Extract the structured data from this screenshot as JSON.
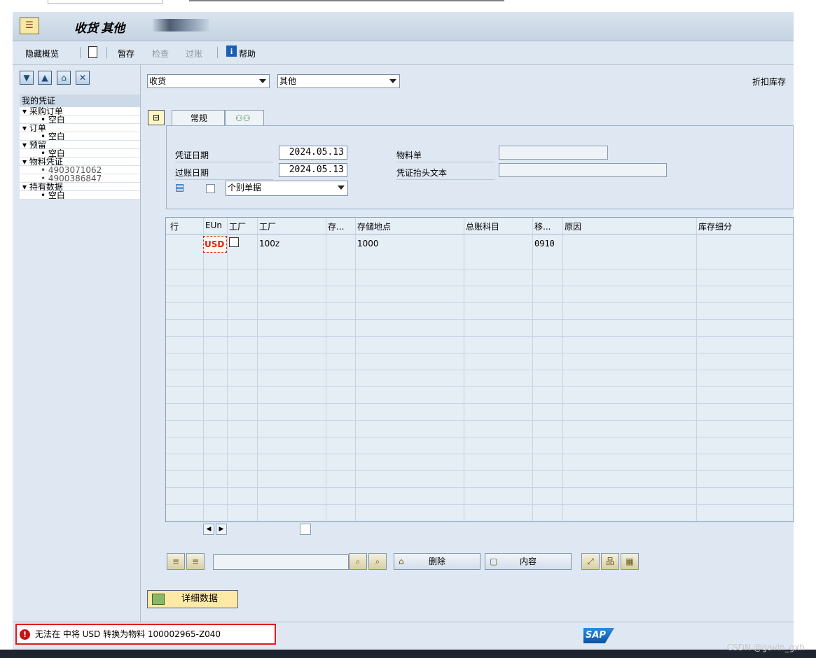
{
  "window": {
    "title": "收货 其他"
  },
  "toolbar": {
    "hide_overview": "隐藏概览",
    "save_draft": "暂存",
    "check": "检查",
    "post": "过账",
    "help": "帮助"
  },
  "tree": {
    "header": "我的凭证",
    "groups": [
      {
        "label": "采购订单",
        "children": [
          "空白"
        ]
      },
      {
        "label": "订单",
        "children": [
          "空白"
        ]
      },
      {
        "label": "预留",
        "children": [
          "空白"
        ]
      },
      {
        "label": "物料凭证",
        "children": [
          "4903071062",
          "4900386847"
        ]
      },
      {
        "label": "持有数据",
        "children": [
          "空白"
        ]
      }
    ]
  },
  "header": {
    "transaction": "收货",
    "reference": "其他",
    "right_label": "折扣库存"
  },
  "tabs": [
    {
      "label": "常规"
    },
    {
      "label": "",
      "icon": "persons-icon"
    }
  ],
  "form": {
    "doc_date_label": "凭证日期",
    "doc_date": "2024.05.13",
    "post_date_label": "过账日期",
    "post_date": "2024.05.13",
    "print_option": "个别单据",
    "material_slip_label": "物料单",
    "material_slip": "",
    "header_text_label": "凭证抬头文本",
    "header_text": ""
  },
  "grid": {
    "columns": [
      "行",
      "EUn",
      "工厂",
      "工厂",
      "存...",
      "存储地点",
      "总账科目",
      "移...",
      "原因",
      "库存细分"
    ],
    "rows": [
      {
        "line": "",
        "eun": "USD",
        "plant": "100z",
        "storage": "1000",
        "mvmt": "0910"
      }
    ]
  },
  "buttons": {
    "delete": "删除",
    "content": "内容",
    "detail": "详细数据"
  },
  "status": {
    "type": "error",
    "message": "无法在 中将 USD 转换为物料 100002965-Z040"
  },
  "brand": {
    "logo": "SAP"
  },
  "watermark": "CSDN @gavin_gxh",
  "colors": {
    "error": "#e01b1b",
    "accent": "#1a5fb4"
  }
}
